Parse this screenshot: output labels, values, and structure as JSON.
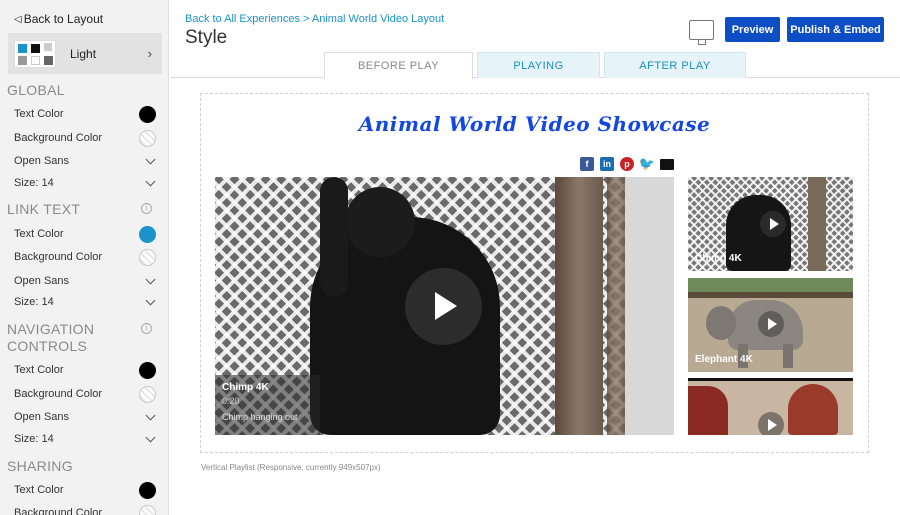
{
  "sidebar": {
    "back_label": "Back to Layout",
    "theme": {
      "label": "Light"
    },
    "sections": [
      {
        "title": "GLOBAL",
        "rows": [
          {
            "label": "Text Color",
            "control": "swatch",
            "color": "#000000"
          },
          {
            "label": "Background Color",
            "control": "swatch-empty"
          },
          {
            "label": "Open Sans",
            "control": "dropdown"
          },
          {
            "label": "Size: 14",
            "control": "dropdown"
          }
        ]
      },
      {
        "title": "LINK TEXT",
        "rows": [
          {
            "label": "Text Color",
            "control": "swatch",
            "color": "#1a93c8"
          },
          {
            "label": "Background Color",
            "control": "swatch-empty"
          },
          {
            "label": "Open Sans",
            "control": "dropdown"
          },
          {
            "label": "Size: 14",
            "control": "dropdown"
          }
        ]
      },
      {
        "title_line1": "NAVIGATION",
        "title_line2": "CONTROLS",
        "rows": [
          {
            "label": "Text Color",
            "control": "swatch",
            "color": "#000000"
          },
          {
            "label": "Background Color",
            "control": "swatch-empty"
          },
          {
            "label": "Open Sans",
            "control": "dropdown"
          },
          {
            "label": "Size: 14",
            "control": "dropdown"
          }
        ]
      },
      {
        "title": "SHARING",
        "rows": [
          {
            "label": "Text Color",
            "control": "swatch",
            "color": "#000000"
          },
          {
            "label": "Background Color",
            "control": "swatch-empty"
          }
        ]
      }
    ]
  },
  "header": {
    "breadcrumb": "Back to All Experiences > Animal World Video Layout",
    "title": "Style",
    "preview_label": "Preview",
    "publish_label": "Publish & Embed"
  },
  "tabs": [
    {
      "label": "BEFORE PLAY",
      "active": true
    },
    {
      "label": "PLAYING",
      "active": false
    },
    {
      "label": "AFTER PLAY",
      "active": false
    }
  ],
  "preview": {
    "title": "Animal World Video Showcase",
    "social_icons": [
      "facebook-icon",
      "linkedin-icon",
      "pinterest-icon",
      "twitter-icon",
      "email-icon"
    ],
    "main_video": {
      "title": "Chimp 4K",
      "duration": "0:20",
      "caption": "Chimp hanging out"
    },
    "playlist": [
      {
        "title": "Chimp 4K"
      },
      {
        "title": "Elephant 4K"
      },
      {
        "title": ""
      }
    ],
    "footer_note": "Vertical Playlist (Responsive, currently 949x507px)"
  },
  "colors": {
    "accent": "#1a93c8",
    "button": "#0d4ec4",
    "showcase_title": "#1446e0"
  }
}
